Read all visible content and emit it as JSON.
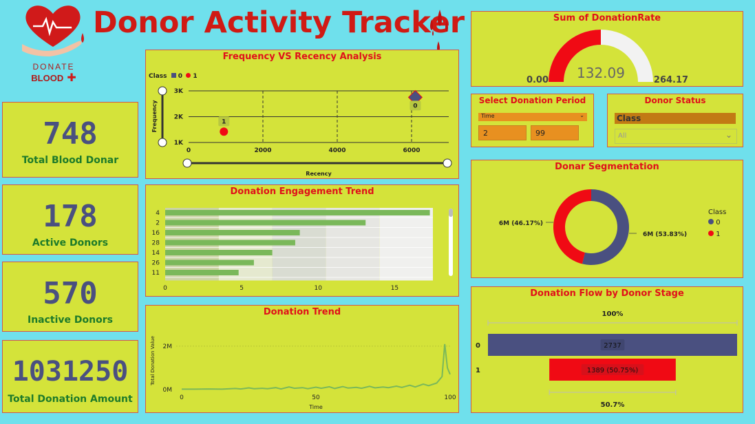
{
  "header": {
    "title": "Donor Activity Tracker",
    "logo_line1": "DONATE",
    "logo_line2": "BLOOD"
  },
  "kpis": [
    {
      "value": "748",
      "label": "Total Blood Donar"
    },
    {
      "value": "178",
      "label": "Active Donors"
    },
    {
      "value": "570",
      "label": "Inactive Donors"
    },
    {
      "value": "1031250",
      "label": "Total Donation Amount"
    }
  ],
  "gauge": {
    "title": "Sum of DonationRate",
    "min": "0.00",
    "value": "132.09",
    "max": "264.17",
    "fraction": 0.5
  },
  "period": {
    "title": "Select Donation Period",
    "field": "Time",
    "from": "2",
    "to": "99"
  },
  "status": {
    "title": "Donor Status",
    "field": "Class",
    "selected": "All"
  },
  "scatter": {
    "title": "Frequency VS Recency Analysis",
    "legend_title": "Class",
    "legend": [
      "0",
      "1"
    ]
  },
  "engagement": {
    "title": "Donation Engagement Trend"
  },
  "trend": {
    "title": "Donation Trend"
  },
  "segmentation": {
    "title": "Donar Segmentation",
    "legend_title": "Class",
    "legend": [
      "0",
      "1"
    ]
  },
  "funnel": {
    "title": "Donation Flow by Donor Stage",
    "top_label": "100%",
    "bottom_label": "50.7%"
  },
  "colors": {
    "class0": "#4a5080",
    "class1": "#f00a14",
    "bar": "#7ab85a",
    "line": "#7ab85a"
  },
  "chart_data": [
    {
      "type": "scatter",
      "title": "Frequency VS Recency Analysis",
      "xlabel": "Recency",
      "ylabel": "Frequency",
      "xlim": [
        0,
        7000
      ],
      "ylim": [
        1000,
        3000
      ],
      "xticks": [
        "0",
        "2000",
        "4000",
        "6000"
      ],
      "yticks": [
        "1K",
        "2K",
        "3K"
      ],
      "series": [
        {
          "name": "0",
          "points": [
            {
              "x": 6100,
              "y": 2750,
              "label": "0"
            }
          ]
        },
        {
          "name": "1",
          "points": [
            {
              "x": 950,
              "y": 1420,
              "label": "1"
            }
          ]
        }
      ],
      "grid": true
    },
    {
      "type": "bar",
      "title": "Donation Engagement Trend",
      "orientation": "horizontal",
      "categories": [
        "4",
        "2",
        "16",
        "28",
        "14",
        "26",
        "11"
      ],
      "values": [
        17.3,
        13.1,
        8.8,
        8.5,
        7.0,
        5.8,
        4.8
      ],
      "xlim": [
        0,
        17.5
      ],
      "xticks": [
        "0",
        "5",
        "10",
        "15"
      ]
    },
    {
      "type": "line",
      "title": "Donation Trend",
      "xlabel": "Time",
      "ylabel": "Total Donation Value",
      "xlim": [
        0,
        100
      ],
      "ylim": [
        0,
        2600000
      ],
      "xticks": [
        "0",
        "50",
        "100"
      ],
      "yticks": [
        "0M",
        "2M"
      ],
      "x": [
        0,
        5,
        10,
        15,
        20,
        22,
        25,
        27,
        30,
        32,
        35,
        37,
        40,
        42,
        45,
        47,
        50,
        52,
        55,
        57,
        60,
        62,
        65,
        67,
        70,
        72,
        75,
        77,
        80,
        82,
        85,
        87,
        90,
        92,
        95,
        97,
        98,
        99,
        100
      ],
      "y": [
        20000,
        20000,
        30000,
        20000,
        50000,
        30000,
        80000,
        40000,
        60000,
        40000,
        90000,
        30000,
        120000,
        60000,
        90000,
        40000,
        110000,
        60000,
        130000,
        50000,
        140000,
        70000,
        100000,
        60000,
        150000,
        80000,
        120000,
        90000,
        160000,
        100000,
        200000,
        120000,
        250000,
        180000,
        300000,
        600000,
        2100000,
        1000000,
        700000
      ]
    },
    {
      "type": "pie",
      "title": "Donar Segmentation",
      "donut": true,
      "slices": [
        {
          "name": "0",
          "value": 53.83,
          "label": "6M (53.83%)"
        },
        {
          "name": "1",
          "value": 46.17,
          "label": "6M (46.17%)"
        }
      ]
    },
    {
      "type": "bar",
      "title": "Donation Flow by Donor Stage",
      "categories": [
        "0",
        "1"
      ],
      "values": [
        2737,
        1389
      ],
      "labels": [
        "2737",
        "1389 (50.75%)"
      ]
    }
  ]
}
